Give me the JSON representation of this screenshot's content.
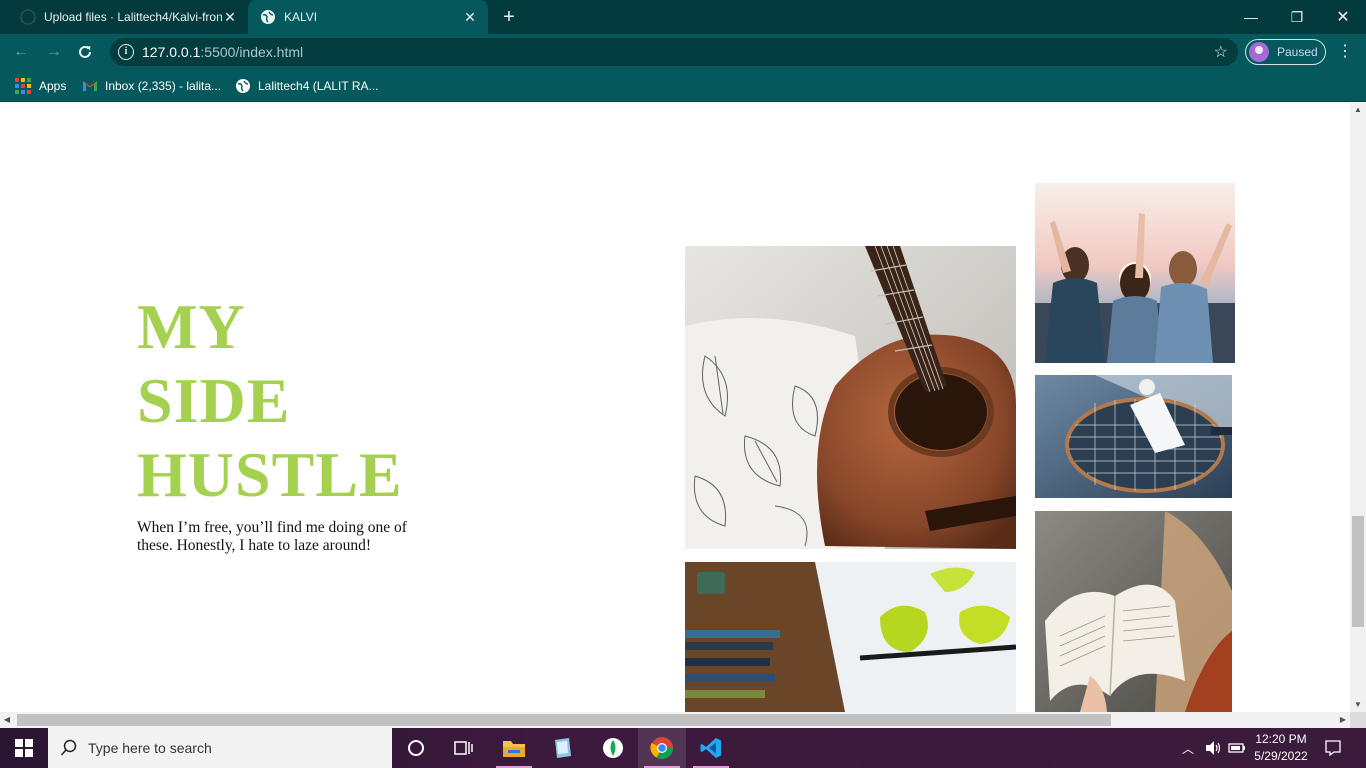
{
  "browser": {
    "tabs": [
      {
        "title": "Upload files · Lalittech4/Kalvi-fron",
        "active": false,
        "icon": "github-icon"
      },
      {
        "title": "KALVI",
        "active": true,
        "icon": "globe-icon"
      }
    ],
    "new_tab": "+",
    "window_controls": {
      "minimize": "—",
      "restore": "❐",
      "close": "✕"
    },
    "address": {
      "host": "127.0.0.1",
      "path": ":5500/index.html"
    },
    "profile_status": "Paused",
    "bookmarks": [
      {
        "label": "Apps",
        "icon": "apps-grid-icon"
      },
      {
        "label": "Inbox (2,335) - lalita...",
        "icon": "gmail-icon"
      },
      {
        "label": "Lalittech4 (LALIT RA...",
        "icon": "github-icon"
      }
    ]
  },
  "hero": {
    "title_lines": [
      "MY",
      "SIDE",
      "HUSTLE"
    ],
    "description": "When I’m free, you’ll find me doing one of these. Honestly, I hate to laze around!",
    "accent_color": "#a5d151"
  },
  "gallery": [
    {
      "subject": "guitar-photo"
    },
    {
      "subject": "friends-sunset-photo"
    },
    {
      "subject": "badminton-photo"
    },
    {
      "subject": "painting-photo"
    },
    {
      "subject": "reading-book-photo"
    }
  ],
  "taskbar": {
    "search_placeholder": "Type here to search",
    "apps": [
      "cortana-icon",
      "task-view-icon",
      "file-explorer-icon",
      "notepad-icon",
      "mongodb-icon",
      "chrome-icon",
      "vscode-icon"
    ],
    "time": "12:20 PM",
    "date": "5/29/2022"
  }
}
